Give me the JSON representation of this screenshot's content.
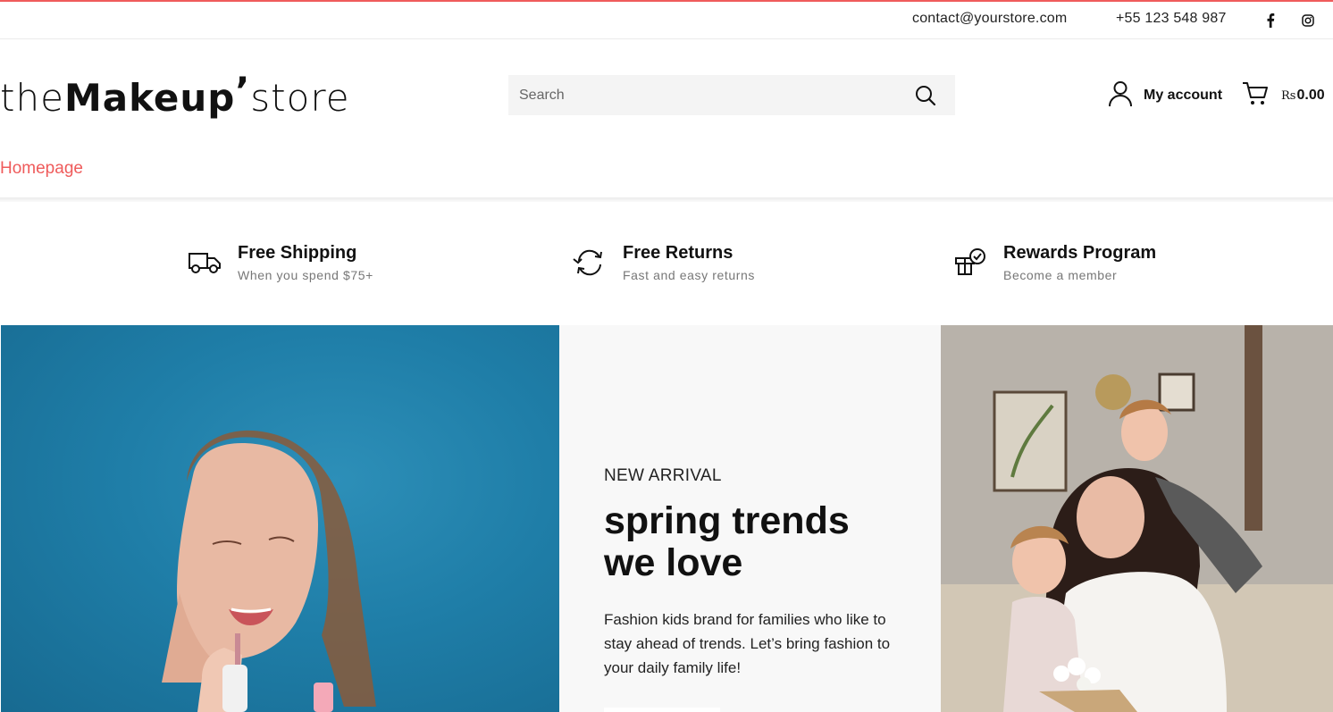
{
  "topbar": {
    "contact": "contact@yourstore.com",
    "phone": "+55 123 548 987",
    "social": [
      "facebook-icon",
      "instagram-icon"
    ]
  },
  "logo": {
    "part1": "the",
    "part2": "Makeup",
    "part3": "’",
    "part4": "store"
  },
  "search": {
    "placeholder": "Search"
  },
  "header": {
    "account_label": "My account",
    "cart_currency": "Rs",
    "cart_amount": "0.00"
  },
  "nav": {
    "items": [
      {
        "label": "Homepage",
        "active": true
      }
    ]
  },
  "features": [
    {
      "icon": "truck-icon",
      "title": "Free Shipping",
      "subtitle": "When you spend $75+"
    },
    {
      "icon": "returns-icon",
      "title": "Free Returns",
      "subtitle": "Fast and easy returns"
    },
    {
      "icon": "rewards-box-icon",
      "title": "Rewards Program",
      "subtitle": "Become a member"
    }
  ],
  "promo": {
    "eyebrow": "NEW ARRIVAL",
    "headline": "spring trends we love",
    "description": "Fashion kids brand for families who like to stay ahead of trends. Let’s bring fashion to your daily family life!"
  },
  "colors": {
    "accent": "#ef5b5b",
    "text": "#111111",
    "muted": "#777777",
    "search_bg": "#f4f4f4",
    "banner_blue": "#1f7ea8"
  }
}
